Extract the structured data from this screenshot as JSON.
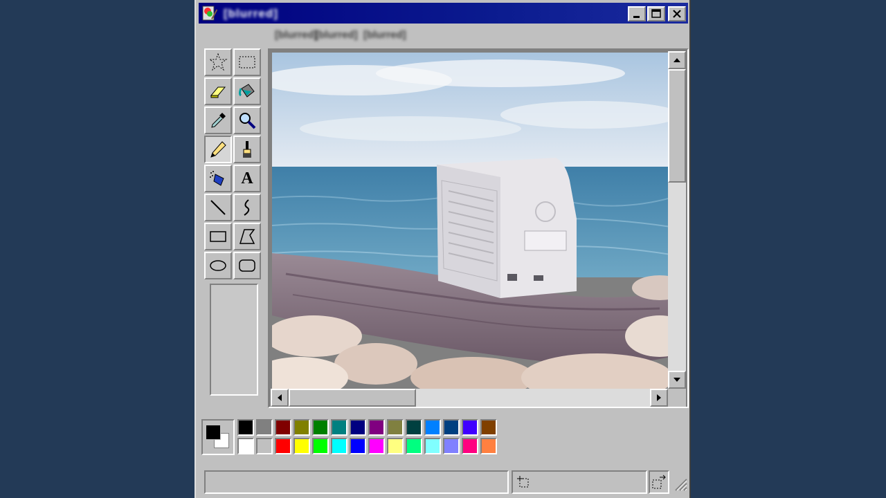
{
  "window": {
    "title": "[blurred]",
    "controls": [
      "minimize-icon",
      "maximize-icon",
      "close-icon"
    ]
  },
  "menu": {
    "items": [
      "[blurred]",
      "[blurred]",
      "[blurred]"
    ]
  },
  "toolbox": {
    "tools": [
      {
        "name": "free-form-select",
        "icon": "star-select-icon"
      },
      {
        "name": "select",
        "icon": "rect-select-icon"
      },
      {
        "name": "eraser",
        "icon": "eraser-icon"
      },
      {
        "name": "fill",
        "icon": "paint-bucket-icon"
      },
      {
        "name": "pick-color",
        "icon": "eyedropper-icon"
      },
      {
        "name": "magnifier",
        "icon": "magnifier-icon"
      },
      {
        "name": "pencil",
        "icon": "pencil-icon",
        "active": true
      },
      {
        "name": "brush",
        "icon": "brush-icon"
      },
      {
        "name": "airbrush",
        "icon": "airbrush-icon"
      },
      {
        "name": "text",
        "icon": "text-icon",
        "glyph": "A"
      },
      {
        "name": "line",
        "icon": "line-icon"
      },
      {
        "name": "curve",
        "icon": "curve-icon"
      },
      {
        "name": "rectangle",
        "icon": "rectangle-icon"
      },
      {
        "name": "polygon",
        "icon": "polygon-icon"
      },
      {
        "name": "ellipse",
        "icon": "ellipse-icon"
      },
      {
        "name": "rounded-rectangle",
        "icon": "rounded-rect-icon"
      }
    ]
  },
  "canvas": {
    "image": "photo of beige CRT monitor on driftwood log by the sea"
  },
  "palette": {
    "foreground": "#000000",
    "background": "#ffffff",
    "row1": [
      "#000000",
      "#808080",
      "#800000",
      "#808000",
      "#008000",
      "#008080",
      "#000080",
      "#800080",
      "#808040",
      "#004040",
      "#0080ff",
      "#004080",
      "#4000ff",
      "#804000"
    ],
    "row2": [
      "#ffffff",
      "#c0c0c0",
      "#ff0000",
      "#ffff00",
      "#00ff00",
      "#00ffff",
      "#0000ff",
      "#ff00ff",
      "#ffff80",
      "#00ff80",
      "#80ffff",
      "#8080ff",
      "#ff0080",
      "#ff8040"
    ]
  },
  "status": {
    "text": "",
    "position_icon": "position-icon",
    "size_icon": "size-icon"
  }
}
